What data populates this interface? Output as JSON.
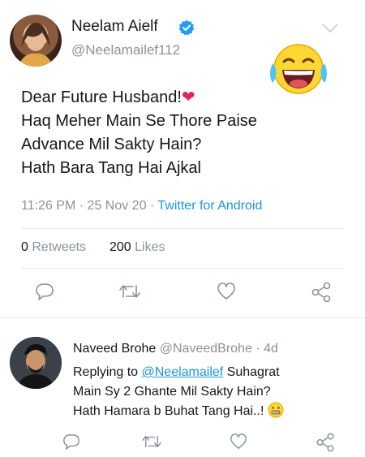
{
  "main_tweet": {
    "author_name": "Neelam Aielf",
    "handle": "@Neelamailef112",
    "text_lines": [
      "Dear Future Husband!",
      "Haq Meher Main Se Thore Paise",
      "Advance Mil Sakty Hain?",
      "Hath Bara Tang Hai Ajkal"
    ],
    "heart_emoji": "❤",
    "time": "11:26 PM",
    "date": "25 Nov 20",
    "source": "Twitter for Android",
    "retweets_count": "0",
    "retweets_label": "Retweets",
    "likes_count": "200",
    "likes_label": "Likes"
  },
  "reply_tweet": {
    "author_name": "Naveed Brohe",
    "handle": "@NaveedBrohe",
    "age": "4d",
    "replying_prefix": "Replying to",
    "replying_to": "@Neelamailef",
    "text_line1_rest": "Suhagrat",
    "text_line2": "Main Sy 2 Ghante Mil Sakty Hain?",
    "text_line3": "Hath Hamara b Buhat Tang Hai..!"
  },
  "separators": {
    "dot": "·"
  },
  "colors": {
    "link_blue": "#1b95e0",
    "secondary_gray": "#8a9399",
    "verified_blue": "#1da1f2",
    "heart_red": "#e0245e"
  },
  "icons": [
    "verified-badge-icon",
    "chevron-down-icon",
    "laughing-emoji-icon",
    "reply-icon",
    "retweet-icon",
    "like-icon",
    "share-icon",
    "grimace-emoji-icon"
  ]
}
